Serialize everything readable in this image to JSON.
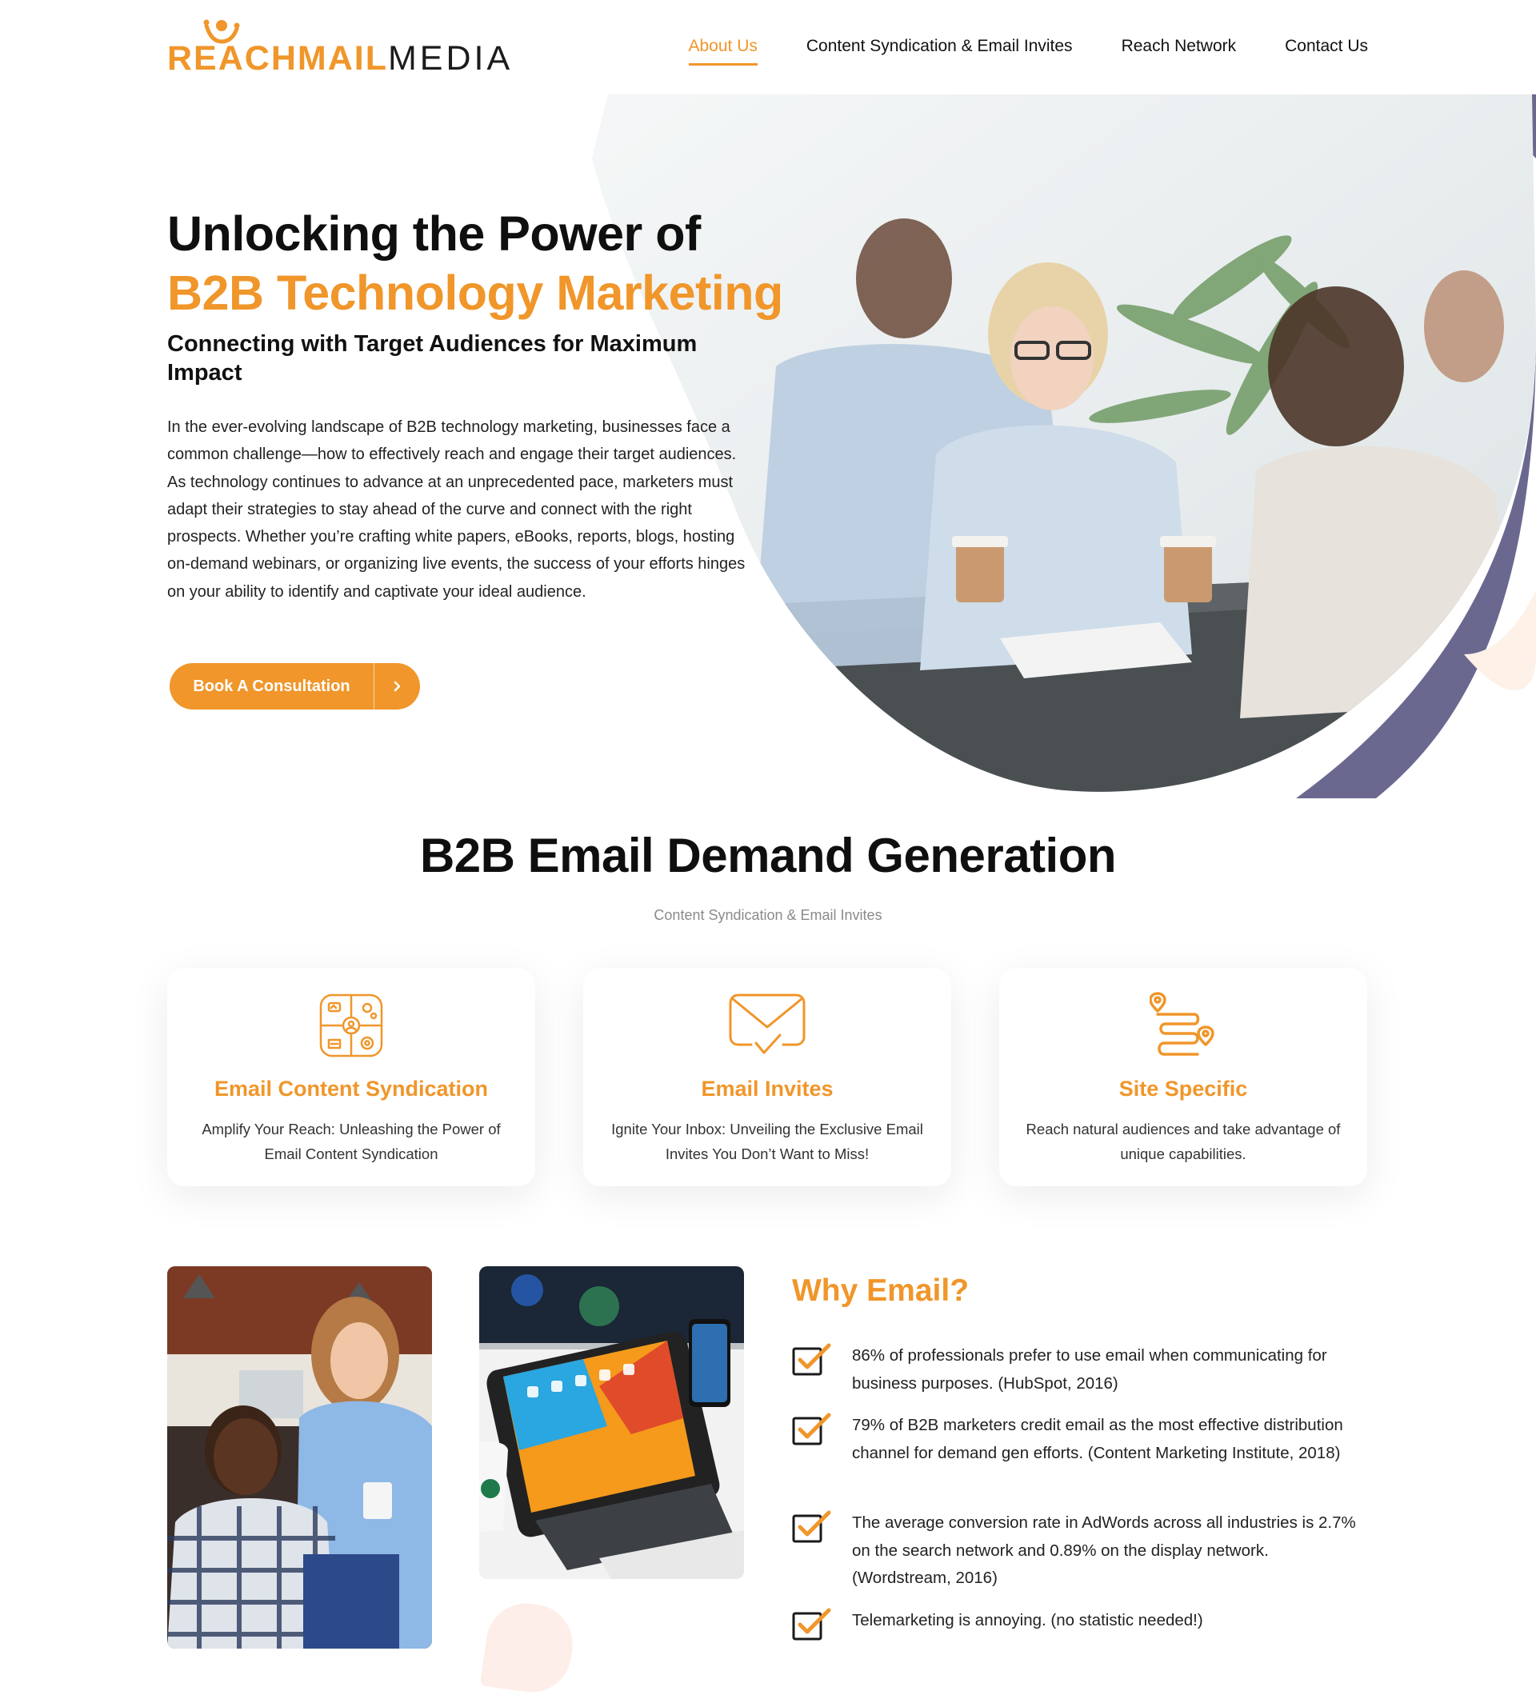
{
  "brand": {
    "name_part1": "REACHMAIL",
    "name_part2": "MEDIA",
    "accent": "#f0962a",
    "purple": "#6b6890"
  },
  "nav": {
    "items": [
      {
        "label": "About Us",
        "active": true
      },
      {
        "label": "Content Syndication & Email Invites",
        "active": false
      },
      {
        "label": "Reach Network",
        "active": false
      },
      {
        "label": "Contact Us",
        "active": false
      }
    ]
  },
  "hero": {
    "title_line1": "Unlocking the Power of",
    "title_line2": "B2B Technology Marketing",
    "subtitle": "Connecting with Target Audiences for Maximum Impact",
    "body": "In the ever-evolving landscape of B2B technology marketing, businesses face a common challenge—how to effectively reach and engage their target audiences. As technology continues to advance at an unprecedented pace, marketers must adapt their strategies to stay ahead of the curve and connect with the right prospects. Whether you’re crafting white papers, eBooks, reports, blogs, hosting on-demand webinars, or organizing live events, the success of your efforts hinges on your ability to identify and captivate your ideal audience.",
    "cta_label": "Book A Consultation",
    "cta_icon": "chevron-right-icon"
  },
  "demand": {
    "title": "B2B Email Demand Generation",
    "subtitle": "Content Syndication & Email Invites",
    "cards": [
      {
        "icon": "puzzle-network-icon",
        "title": "Email Content Syndication",
        "text": "Amplify Your Reach: Unleashing the Power of Email Content Syndication"
      },
      {
        "icon": "envelope-check-icon",
        "title": "Email Invites",
        "text": "Ignite Your Inbox: Unveiling the Exclusive Email Invites You Don’t Want to Miss!"
      },
      {
        "icon": "route-pin-icon",
        "title": "Site Specific",
        "text": "Reach natural audiences and take advantage of unique capabilities."
      }
    ]
  },
  "why": {
    "title": "Why Email?",
    "items": [
      "86% of professionals prefer to use email when communicating for business purposes. (HubSpot, 2016)",
      "79% of B2B marketers credit email as the most effective distribution channel for demand gen efforts. (Content Marketing Institute, 2018)",
      "The average conversion rate in AdWords across all industries is 2.7% on the search network and 0.89% on the display network. (Wordstream, 2016)",
      "Telemarketing is annoying. (no statistic needed!)"
    ]
  }
}
